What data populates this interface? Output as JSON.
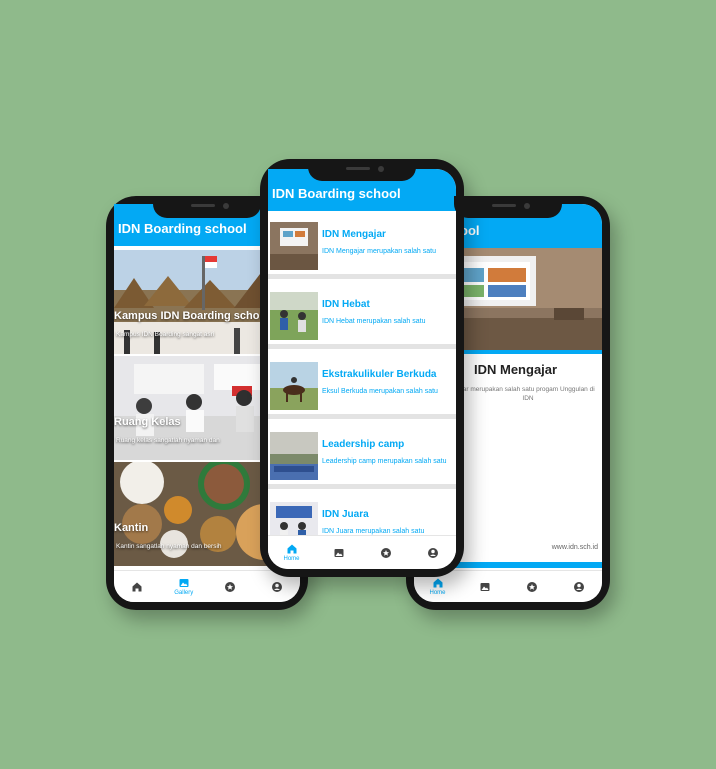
{
  "colors": {
    "background": "#8fba8b",
    "accent": "#03a9f4",
    "frame": "#161616"
  },
  "app": {
    "title": "IDN Boarding school"
  },
  "nav": {
    "home_label": "Home",
    "gallery_label": "Gallery",
    "icons": [
      "home-icon",
      "image-icon",
      "star-icon",
      "account-icon"
    ]
  },
  "gallery": {
    "items": [
      {
        "title": "Kampus IDN Boarding school",
        "subtitle": "Kampus IDN Boarding sangat asri"
      },
      {
        "title": "Ruang Kelas",
        "subtitle": "Ruang kelas sangatlah nyaman dan"
      },
      {
        "title": "Kantin",
        "subtitle": "Kantin sangatlah nyaman dan bersih"
      }
    ]
  },
  "list": {
    "items": [
      {
        "title": "IDN Mengajar",
        "description": "IDN Mengajar merupakan salah satu"
      },
      {
        "title": "IDN Hebat",
        "description": "IDN Hebat merupakan salah satu"
      },
      {
        "title": "Ekstrakulikuler Berkuda",
        "description": "Eksul Berkuda merupakan salah satu"
      },
      {
        "title": "Leadership camp",
        "description": "Leadership camp merupakan salah satu"
      },
      {
        "title": "IDN Juara",
        "description": "IDN Juara merupakan salah satu"
      }
    ]
  },
  "detail": {
    "appbar_title": "ool",
    "title": "IDN Mengajar",
    "description": "jar merupakan salah satu progam Unggulan di IDN",
    "footer": "www.idn.sch.id"
  }
}
